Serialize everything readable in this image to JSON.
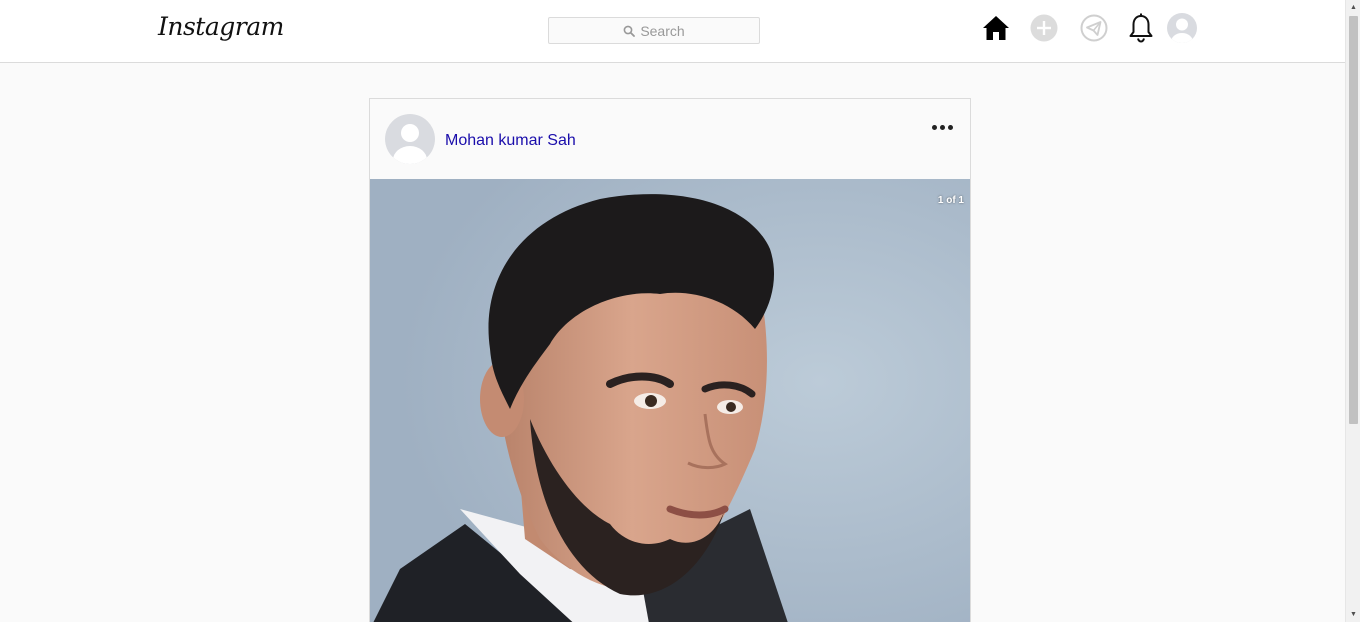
{
  "header": {
    "logo_text": "Instagram",
    "search_placeholder": "Search",
    "icons": [
      "home-icon",
      "add-post-icon",
      "direct-message-icon",
      "notifications-bell-icon",
      "profile-avatar-icon"
    ]
  },
  "post": {
    "username": "Mohan kumar Sah",
    "image_counter": "1 of 1",
    "menu_icon": "more-options-icon"
  },
  "colors": {
    "username_link": "#1a0dab",
    "border": "#dbdbdb",
    "background": "#fafafa"
  }
}
